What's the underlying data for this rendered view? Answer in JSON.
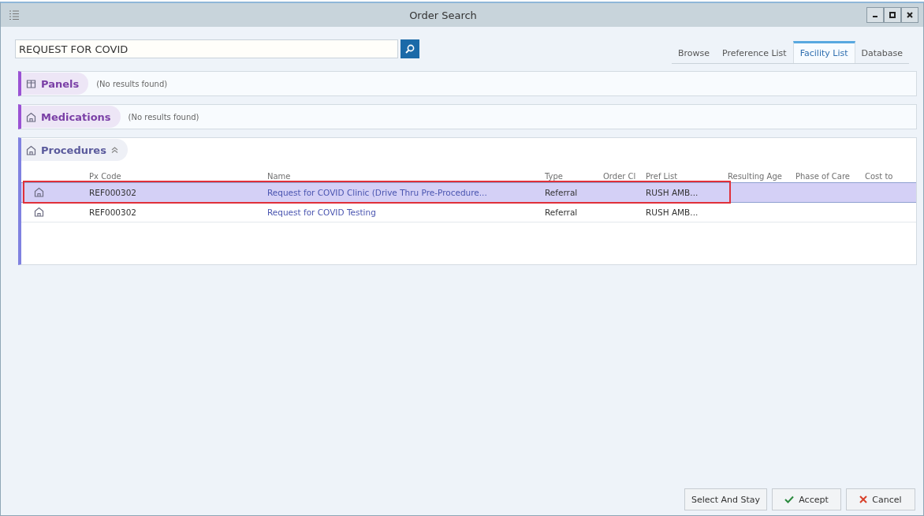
{
  "window": {
    "title": "Order Search"
  },
  "search": {
    "value": "REQUEST FOR COVID"
  },
  "tabs": [
    {
      "label": "Browse",
      "selected": false
    },
    {
      "label": "Preference List",
      "selected": false
    },
    {
      "label": "Facility List",
      "selected": true
    },
    {
      "label": "Database",
      "selected": false
    }
  ],
  "sections": [
    {
      "kind": "panels",
      "title": "Panels",
      "message": "(No results found)"
    },
    {
      "kind": "medications",
      "title": "Medications",
      "message": "(No results found)"
    },
    {
      "kind": "procedures",
      "title": "Procedures",
      "expanded": true,
      "columns": [
        "Px Code",
        "Name",
        "Type",
        "Order Cl",
        "Pref List",
        "Resulting Age",
        "Phase of Care",
        "Cost to"
      ],
      "rows": [
        {
          "selected": true,
          "highlighted": true,
          "px_code": "REF000302",
          "name": "Request for COVID Clinic (Drive Thru Pre-Procedure...",
          "type": "Referral",
          "pref_list": "RUSH AMB..."
        },
        {
          "selected": false,
          "highlighted": false,
          "px_code": "REF000302",
          "name": "Request for COVID Testing",
          "type": "Referral",
          "pref_list": "RUSH AMB..."
        }
      ]
    }
  ],
  "buttons": [
    {
      "kind": "plain",
      "label": "Select And Stay"
    },
    {
      "kind": "accept",
      "label": "Accept"
    },
    {
      "kind": "cancel",
      "label": "Cancel"
    }
  ]
}
